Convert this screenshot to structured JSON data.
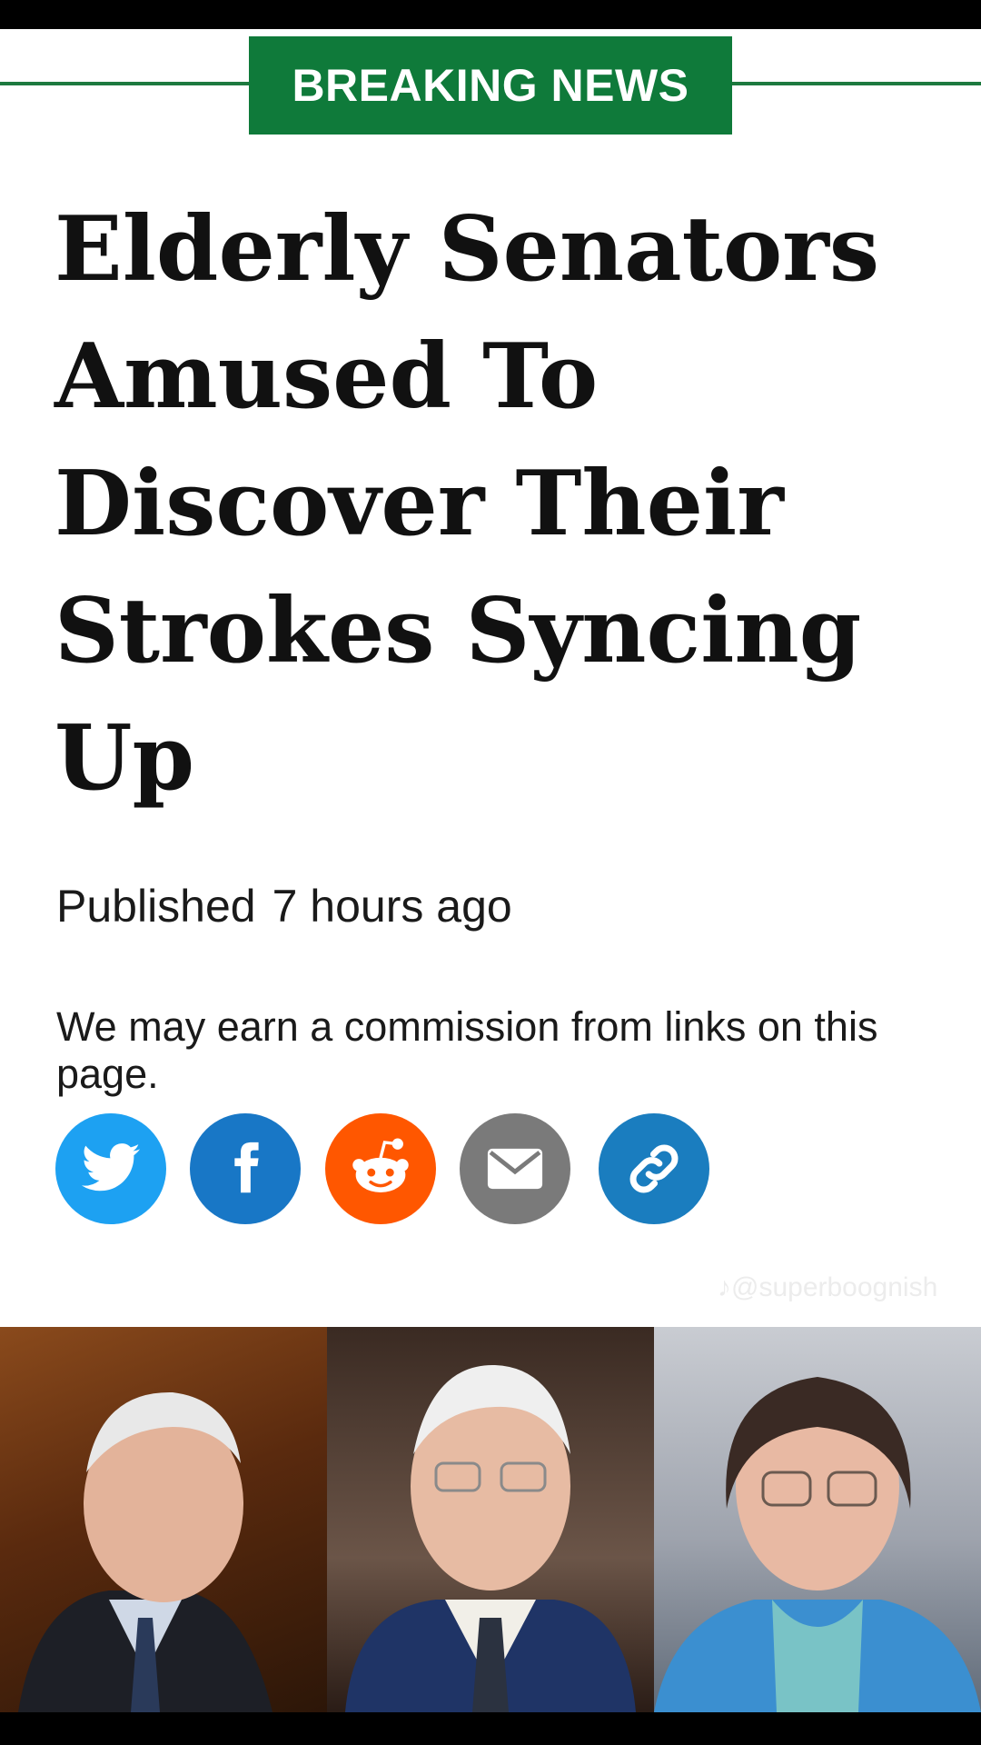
{
  "banner": {
    "label": "BREAKING NEWS"
  },
  "article": {
    "headline": "Elderly Senators Amused To Discover Their Strokes Syncing Up",
    "published_label": "Published",
    "published_time": "7 hours ago",
    "disclaimer": "We may earn a commission from links on this page."
  },
  "share": {
    "icons": [
      "twitter-icon",
      "facebook-icon",
      "reddit-icon",
      "email-icon",
      "link-icon"
    ]
  },
  "watermark": {
    "text": "@superboognish"
  },
  "colors": {
    "banner": "#0f7a3a",
    "twitter": "#1da1f2",
    "facebook": "#1877c6",
    "reddit": "#ff5700",
    "email": "#7a7a7a",
    "link": "#1a7dbf"
  }
}
